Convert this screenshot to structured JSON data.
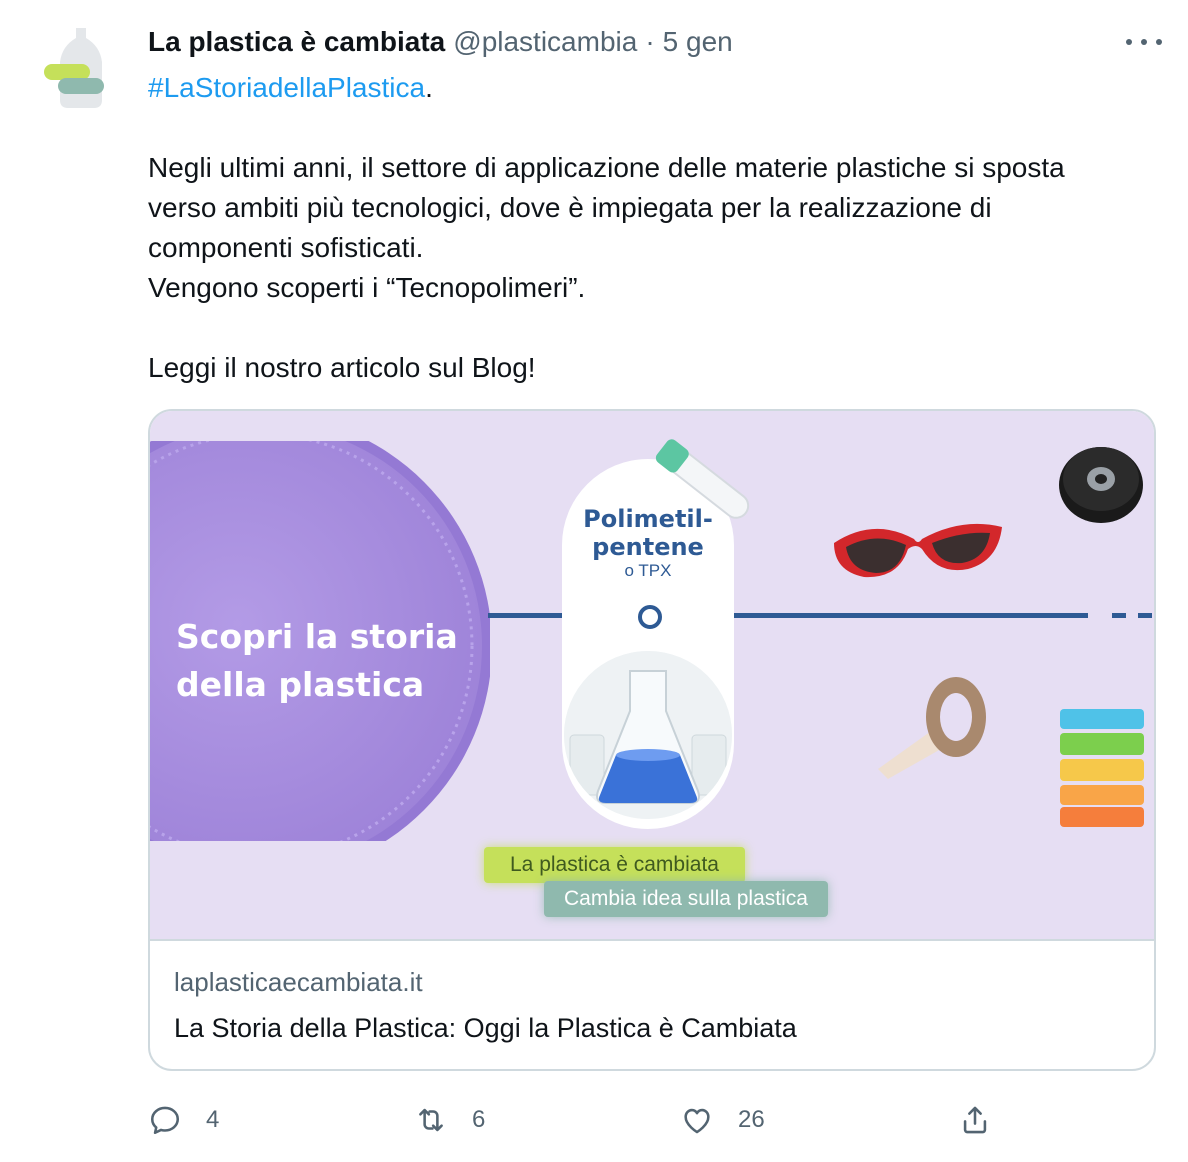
{
  "tweet": {
    "author_name": "La plastica è cambiata",
    "author_handle": "@plasticambia",
    "separator": "·",
    "timestamp": "5 gen",
    "hashtag": "#LaStoriadellaPlastica",
    "hashtag_suffix": ".",
    "paragraph1_line1": "Negli ultimi anni, il settore di applicazione delle materie plastiche si sposta",
    "paragraph1_line2": "verso ambiti più tecnologici, dove è impiegata per la realizzazione di",
    "paragraph1_line3": "componenti sofisticati.",
    "paragraph1_line4": "Vengono scoperti i “Tecnopolimeri”.",
    "paragraph2": "Leggi il nostro articolo sul Blog!"
  },
  "card": {
    "image": {
      "cap_text_line1": "Scopri la storia",
      "cap_text_line2": "della plastica",
      "pill_title_line1": "Polimetil-",
      "pill_title_line2": "pentene",
      "pill_subtitle": "o TPX",
      "label_green": "La plastica è cambiata",
      "label_teal": "Cambia idea sulla plastica"
    },
    "domain": "laplasticaecambiata.it",
    "title": "La Storia della Plastica: Oggi la Plastica è Cambiata"
  },
  "actions": {
    "reply_count": "4",
    "retweet_count": "6",
    "like_count": "26"
  },
  "colors": {
    "link_blue": "#1d9bf0",
    "secondary_text": "#536471",
    "card_bg": "#e6def3",
    "timeline_blue": "#2e5a94",
    "cap_purple": "#a98ee0"
  }
}
